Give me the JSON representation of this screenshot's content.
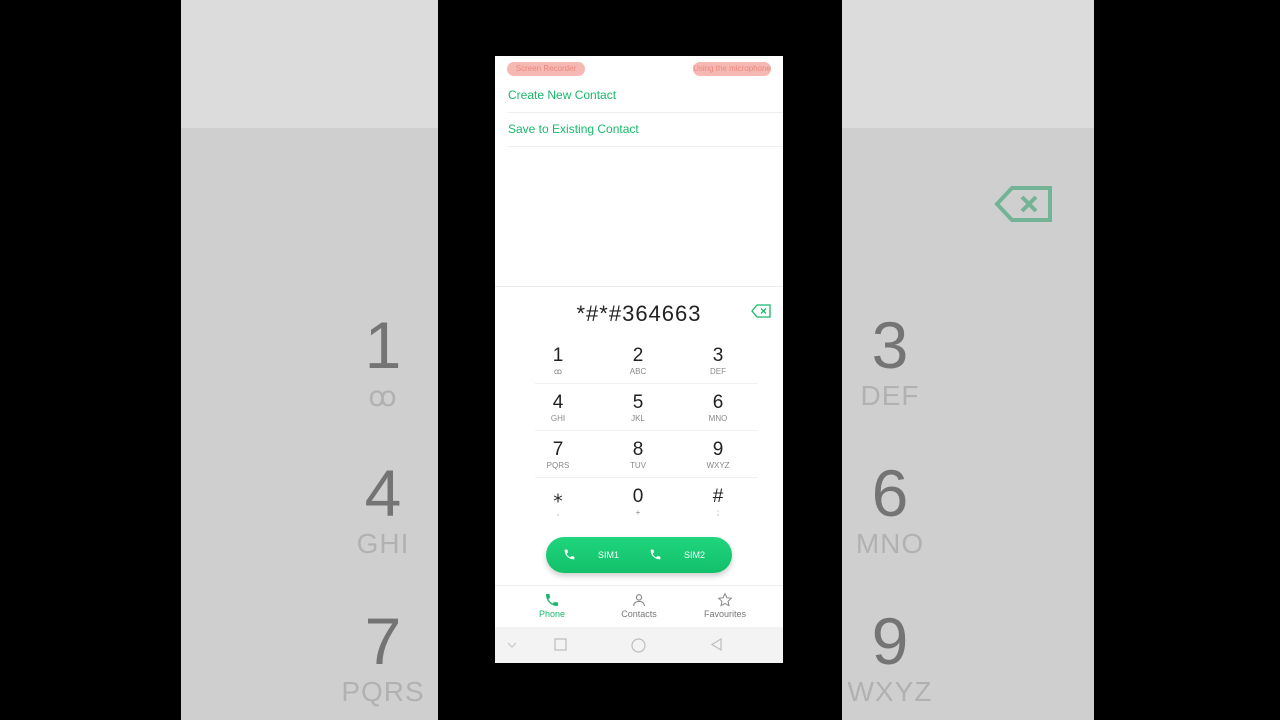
{
  "status_bar": {
    "left_pill": "Screen Recorder",
    "right_pill": "Using the microphone"
  },
  "menu": {
    "create_new": "Create New Contact",
    "save_existing": "Save to Existing Contact"
  },
  "dialer": {
    "number": "*#*#364663",
    "keys": [
      {
        "digit": "1",
        "letters": "ꝏ"
      },
      {
        "digit": "2",
        "letters": "ABC"
      },
      {
        "digit": "3",
        "letters": "DEF"
      },
      {
        "digit": "4",
        "letters": "GHI"
      },
      {
        "digit": "5",
        "letters": "JKL"
      },
      {
        "digit": "6",
        "letters": "MNO"
      },
      {
        "digit": "7",
        "letters": "PQRS"
      },
      {
        "digit": "8",
        "letters": "TUV"
      },
      {
        "digit": "9",
        "letters": "WXYZ"
      },
      {
        "digit": "⁎",
        "letters": ","
      },
      {
        "digit": "0",
        "letters": "+"
      },
      {
        "digit": "#",
        "letters": ";"
      }
    ],
    "sim1_label": "SIM1",
    "sim2_label": "SIM2"
  },
  "tabs": {
    "phone": "Phone",
    "contacts": "Contacts",
    "favourites": "Favourites"
  },
  "background": {
    "keys": [
      {
        "digit": "1",
        "letters": "ꝏ"
      },
      {
        "digit": "3",
        "letters": "DEF"
      },
      {
        "digit": "4",
        "letters": "GHI"
      },
      {
        "digit": "6",
        "letters": "MNO"
      },
      {
        "digit": "7",
        "letters": "PQRS"
      },
      {
        "digit": "9",
        "letters": "WXYZ"
      }
    ]
  },
  "colors": {
    "accent": "#18b86a",
    "call_button": "#1fd57d"
  }
}
